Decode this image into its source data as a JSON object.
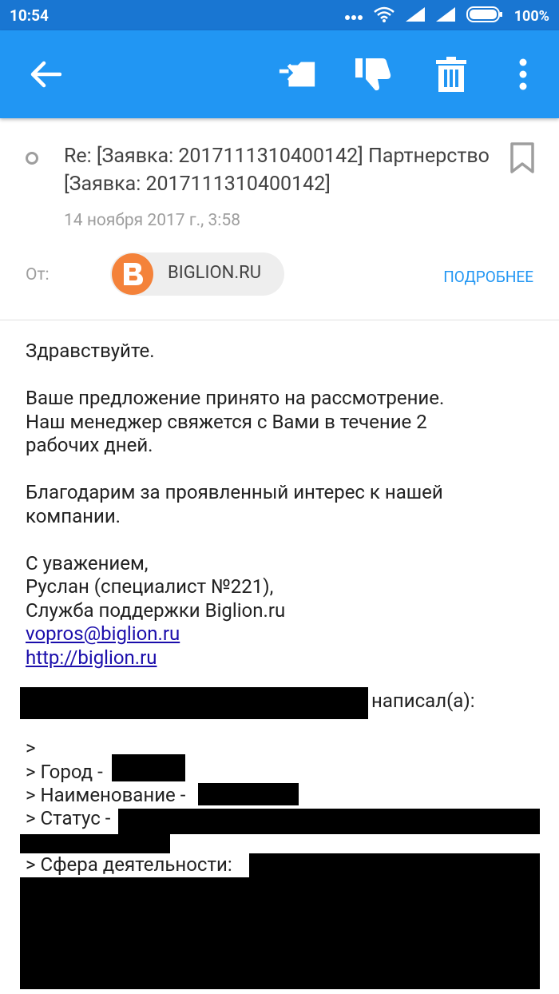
{
  "status_bar": {
    "time": "10:54",
    "battery": "100%",
    "icons": [
      "more-dots-icon",
      "wifi-icon",
      "signal-icon",
      "signal-icon",
      "battery-icon"
    ]
  },
  "app_bar": {
    "icons": [
      "back-arrow-icon",
      "move-to-folder-icon",
      "spam-thumbs-down-icon",
      "trash-icon",
      "overflow-menu-icon"
    ],
    "colors": {
      "bar": "#2196f3",
      "status": "#1976d2"
    }
  },
  "email": {
    "subject": "Re: [Заявка: 2017111310400142] Партнерство [Заявка: 2017111310400142]",
    "date": "14 ноября 2017 г., 3:58",
    "from_label": "От:",
    "sender_name": "BIGLION.RU",
    "sender_avatar_letter": "B",
    "details_label": "ПОДРОБНЕЕ",
    "body": {
      "greeting": "Здравствуйте.",
      "line1": "Ваше предложение принято на рассмотрение.",
      "line2": "Наш менеджер свяжется с Вами в течение 2",
      "line3": "рабочих дней.",
      "line4": "Благодарим за проявленный интерес к нашей",
      "line5": "компании.",
      "sign1": "С уважением,",
      "sign2": "Руслан (специалист №221),",
      "sign3": "Служба поддержки Biglion.ru",
      "email_link": "vopros@biglion.ru",
      "web_link": "http://biglion.ru"
    },
    "quoted": {
      "wrote": "написал(а):",
      "gt": ">",
      "city": "> Город -",
      "name": "> Наименование -",
      "status": "> Статус -",
      "sphere": "> Сфера деятельности:"
    }
  }
}
